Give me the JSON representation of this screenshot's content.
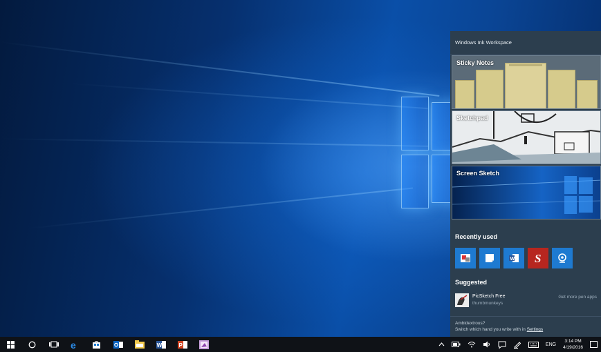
{
  "panel": {
    "title": "Windows Ink Workspace",
    "tiles": [
      {
        "label": "Sticky Notes"
      },
      {
        "label": "Sketchpad"
      },
      {
        "label": "Screen Sketch"
      }
    ],
    "recent_label": "Recently used",
    "recent_apps": [
      "photos-app-icon",
      "sticky-notes-app-icon",
      "word-app-icon",
      "sketchable-app-icon",
      "maps-app-icon"
    ],
    "suggested_label": "Suggested",
    "suggested": {
      "name": "PicSketch Free",
      "publisher": "thumbmunkeys",
      "more": "Get more pen apps"
    },
    "ambidextrous": {
      "question": "Ambidextrous?",
      "text": "Switch which hand you write with in ",
      "link": "Settings"
    }
  },
  "taskbar": {
    "apps": [
      "start-icon",
      "cortana-icon",
      "task-view-icon",
      "edge-icon",
      "store-icon",
      "outlook-icon",
      "file-explorer-icon",
      "word-icon",
      "powerpoint-icon",
      "paint-icon"
    ],
    "language": "ENG",
    "time": "3:14 PM",
    "date": "4/19/2016"
  },
  "colors": {
    "panel_bg": "#2c3e4e",
    "taskbar_bg": "#0f1217",
    "accent": "#1e7ad1"
  }
}
